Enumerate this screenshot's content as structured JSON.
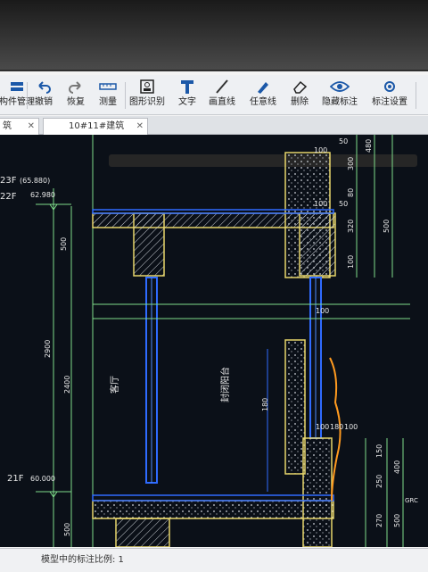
{
  "toolbar": {
    "items": [
      {
        "label": "构件管理",
        "icon": "layers-icon"
      },
      {
        "label": "撤销",
        "icon": "undo-icon"
      },
      {
        "label": "恢复",
        "icon": "redo-icon"
      },
      {
        "label": "测量",
        "icon": "ruler-icon"
      },
      {
        "label": "图形识别",
        "icon": "shape-recognition-icon"
      },
      {
        "label": "文字",
        "icon": "text-icon"
      },
      {
        "label": "画直线",
        "icon": "line-icon"
      },
      {
        "label": "任意线",
        "icon": "pen-icon"
      },
      {
        "label": "删除",
        "icon": "eraser-icon"
      },
      {
        "label": "隐藏标注",
        "icon": "eye-icon"
      },
      {
        "label": "标注设置",
        "icon": "settings-icon"
      }
    ]
  },
  "tabs": [
    {
      "label": "筑"
    },
    {
      "label": "10#11#建筑"
    }
  ],
  "drawing": {
    "levels": [
      {
        "name": "23F",
        "elev": "(65.880)"
      },
      {
        "name": "22F",
        "elev": "62.980"
      },
      {
        "name": "21F",
        "elev": "60.000"
      }
    ],
    "left_dims": [
      "500",
      "2900",
      "2400",
      "500"
    ],
    "rooms": [
      "客厅",
      "封闭阳台"
    ],
    "top_dims": [
      "100",
      "50",
      "100",
      "50"
    ],
    "right_dims": [
      "480",
      "300",
      "80",
      "320",
      "500",
      "100",
      "100"
    ],
    "bottom_dims": [
      "100",
      "180",
      "100",
      "150",
      "250",
      "400",
      "270",
      "500"
    ],
    "misc_texts": [
      "180",
      "GRC"
    ]
  },
  "status": {
    "text": "模型中的标注比例: 1"
  },
  "colors": {
    "canvas_bg": "#0b1018",
    "cad_line": "#e8d66a",
    "wall_blue": "#2f6bff",
    "dim_green": "#7fdc8a"
  }
}
